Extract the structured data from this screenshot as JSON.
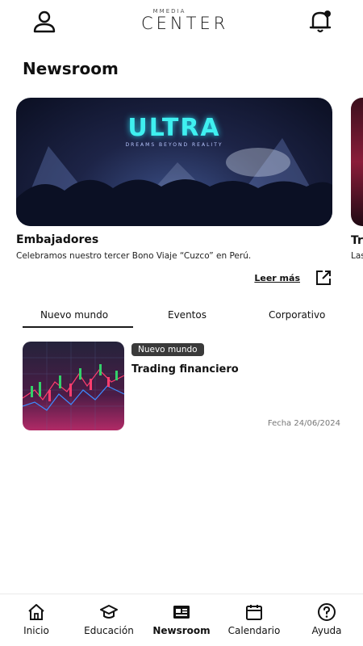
{
  "header": {
    "logo_small": "MMEDIA",
    "logo_big": "CENTER",
    "user_icon": "user-icon",
    "bell_icon": "bell-icon"
  },
  "page": {
    "title": "Newsroom"
  },
  "featured": {
    "hero_text": "ULTRA",
    "hero_sub": "DREAMS BEYOND REALITY",
    "title": "Embajadores",
    "desc": "Celebramos nuestro tercer Bono Viaje “Cuzco” en Perú.",
    "cta": "Leer más",
    "cta_icon": "external-link-icon",
    "next_title": "Tr",
    "next_desc": "Las"
  },
  "tabs": [
    {
      "label": "Nuevo mundo",
      "active": true
    },
    {
      "label": "Eventos",
      "active": false
    },
    {
      "label": "Corporativo",
      "active": false
    }
  ],
  "news": [
    {
      "category": "Nuevo mundo",
      "title": "Trading financiero",
      "date": "Fecha 24/06/2024"
    }
  ],
  "bottom_nav": [
    {
      "label": "Inicio",
      "icon": "home-icon"
    },
    {
      "label": "Educación",
      "icon": "graduation-cap-icon"
    },
    {
      "label": "Newsroom",
      "icon": "newspaper-icon",
      "active": true
    },
    {
      "label": "Calendario",
      "icon": "calendar-icon"
    },
    {
      "label": "Ayuda",
      "icon": "help-icon"
    }
  ],
  "colors": {
    "accent": "#111111",
    "badge": "#3a3a3a",
    "hero_glow": "#3ff0f0"
  }
}
